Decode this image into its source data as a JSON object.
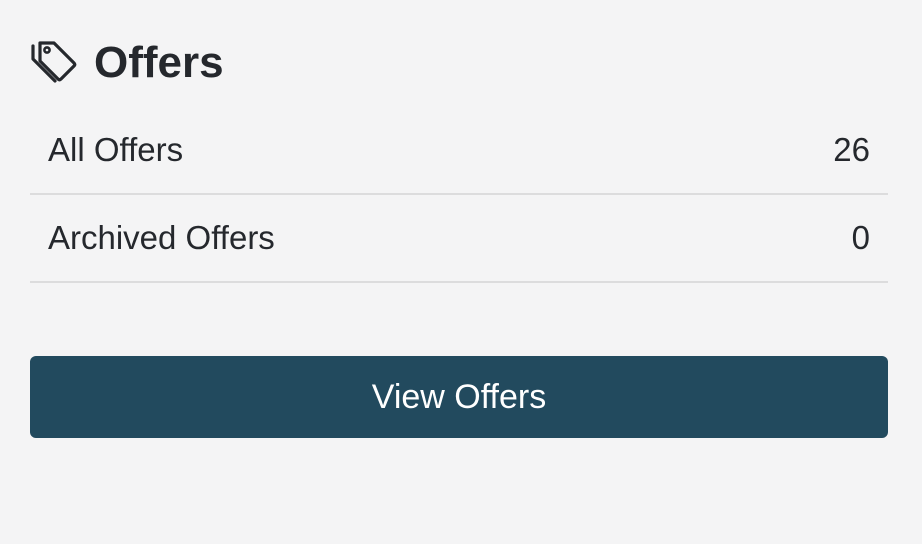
{
  "header": {
    "icon": "tags-icon",
    "title": "Offers"
  },
  "list": {
    "items": [
      {
        "label": "All Offers",
        "count": "26"
      },
      {
        "label": "Archived Offers",
        "count": "0"
      }
    ]
  },
  "actions": {
    "view_label": "View Offers"
  },
  "colors": {
    "button_bg": "#224a5e",
    "button_text": "#ffffff",
    "text": "#25282d",
    "divider": "#dcdcdd",
    "background": "#f4f4f5"
  }
}
